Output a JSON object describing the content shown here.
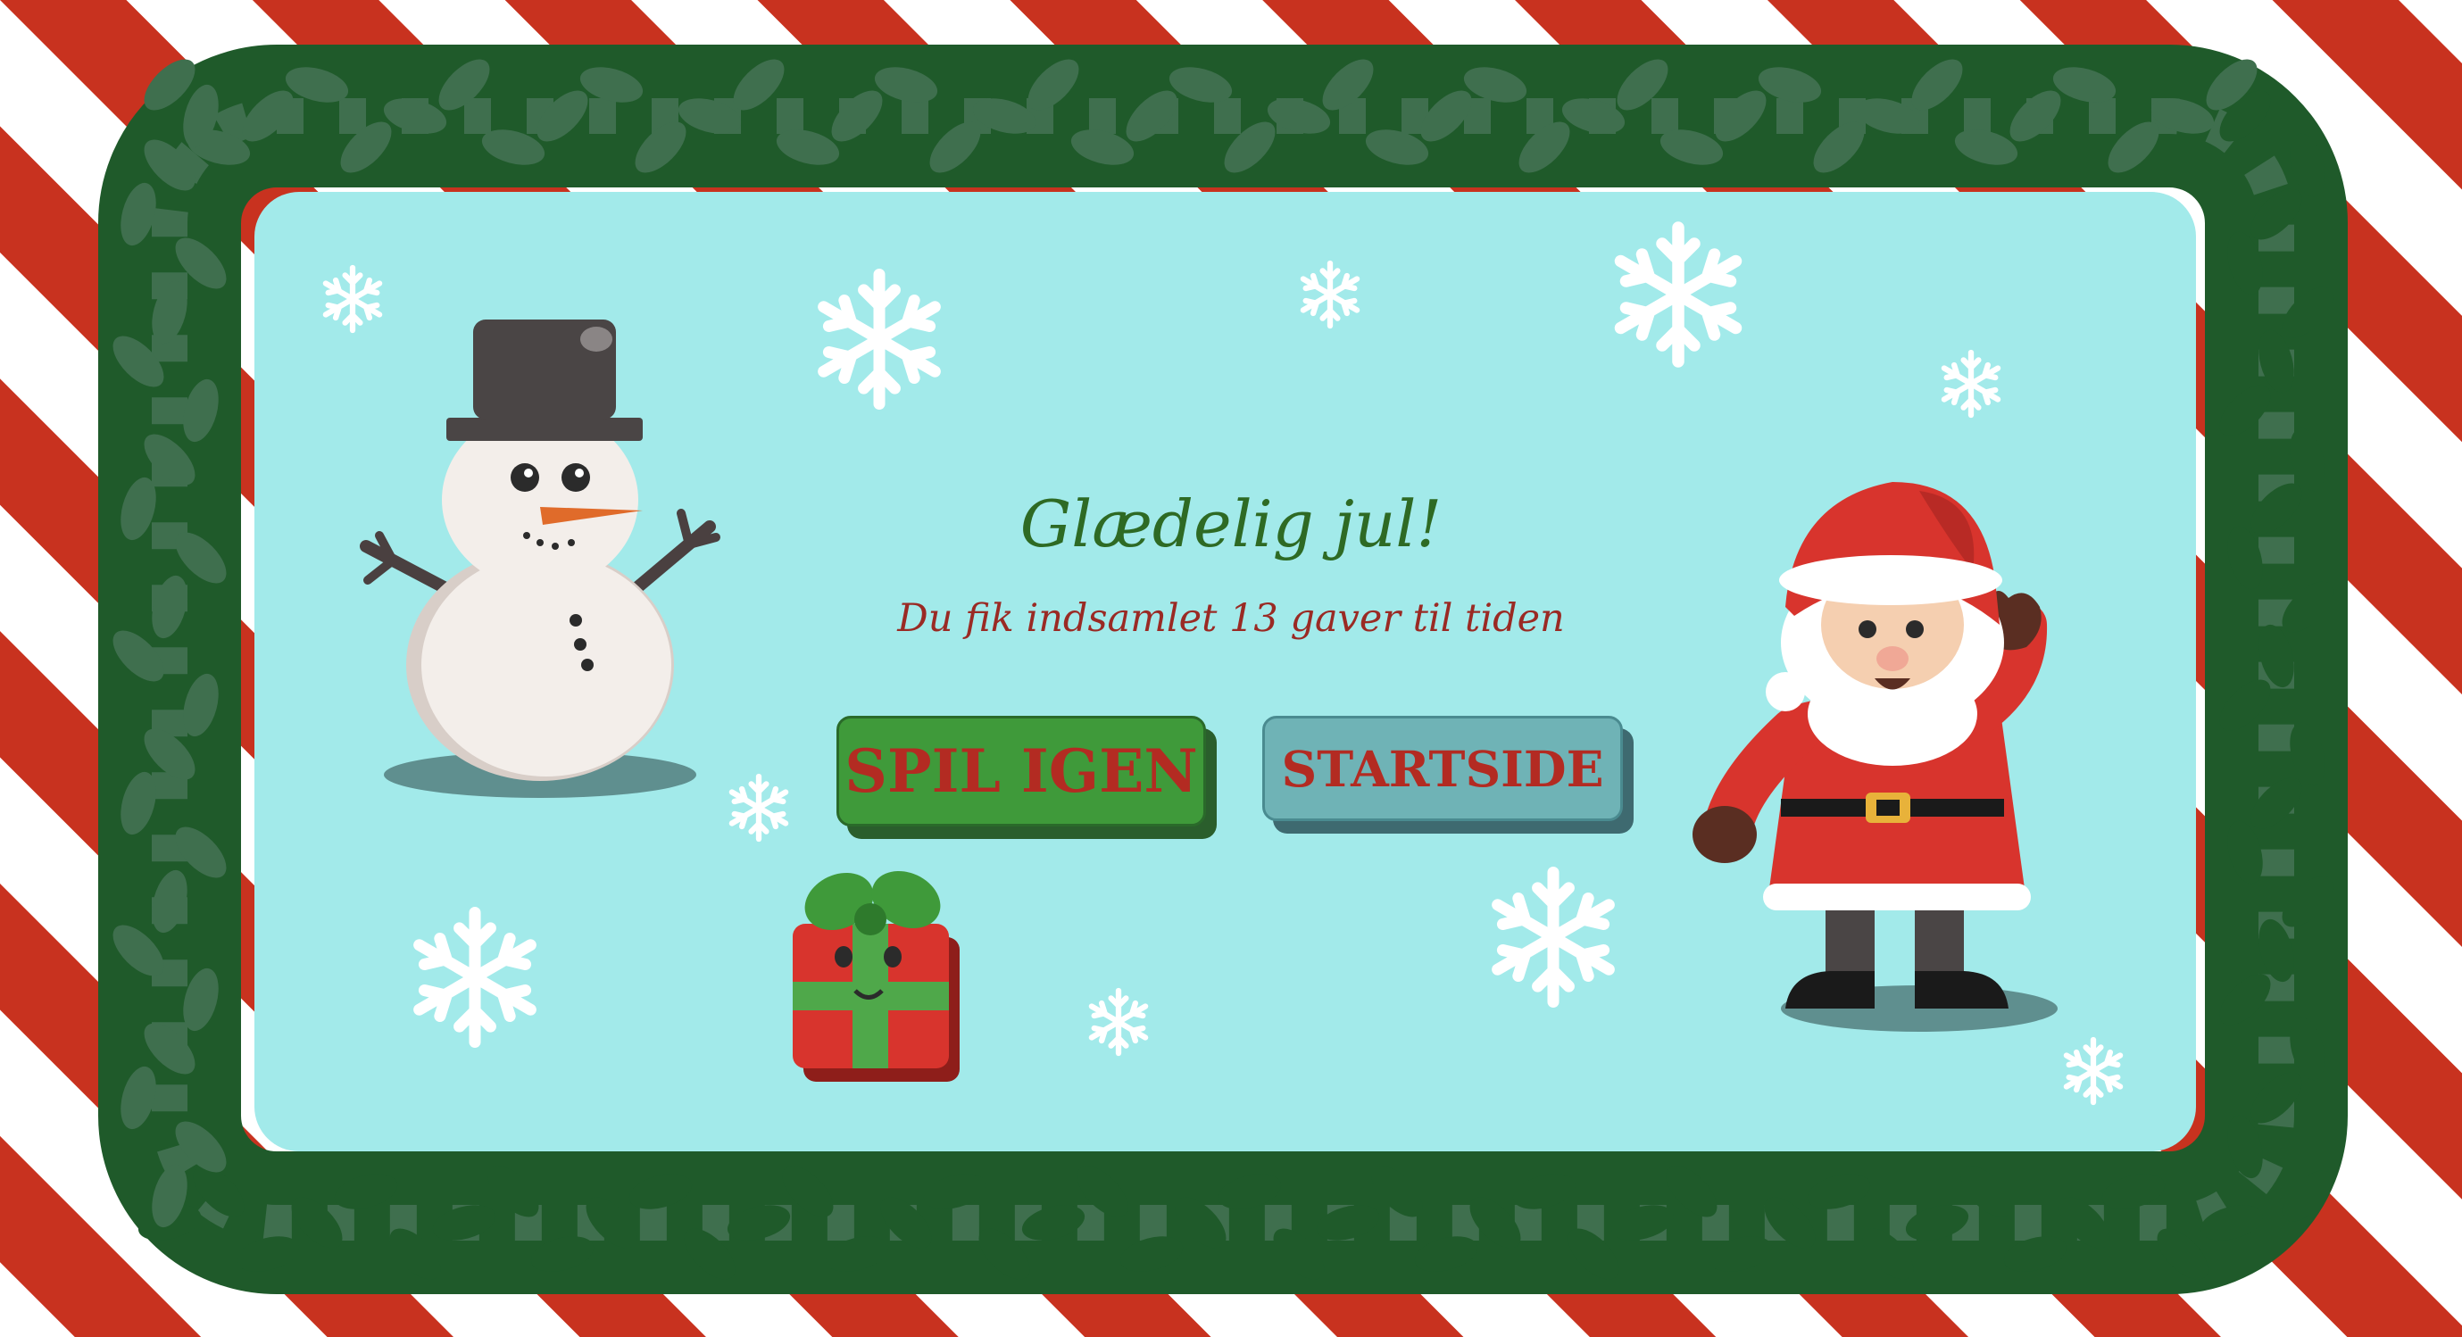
{
  "screen": {
    "title": "Glædelig jul!",
    "message": "Du fik indsamlet 13 gaver til tiden"
  },
  "buttons": {
    "play_again": "SPIL IGEN",
    "start_page": "STARTSIDE"
  },
  "colors": {
    "stripe_red": "#c8321f",
    "stripe_white": "#ffffff",
    "panel_bg": "#a2eaea",
    "garland_dark": "#1f5a2a",
    "garland_light": "#3f6f4e",
    "title_green": "#2e6a24",
    "subtitle_red": "#9a2a24",
    "button_green": "#3f9a3a",
    "button_teal": "#6fb3b6",
    "snowflake": "#ffffff"
  },
  "icons": {
    "characters": [
      "snowman-icon",
      "santa-icon",
      "gift-box-icon"
    ],
    "decor": [
      "snowflake-icon",
      "garland-icon",
      "candy-stripe-background"
    ]
  }
}
